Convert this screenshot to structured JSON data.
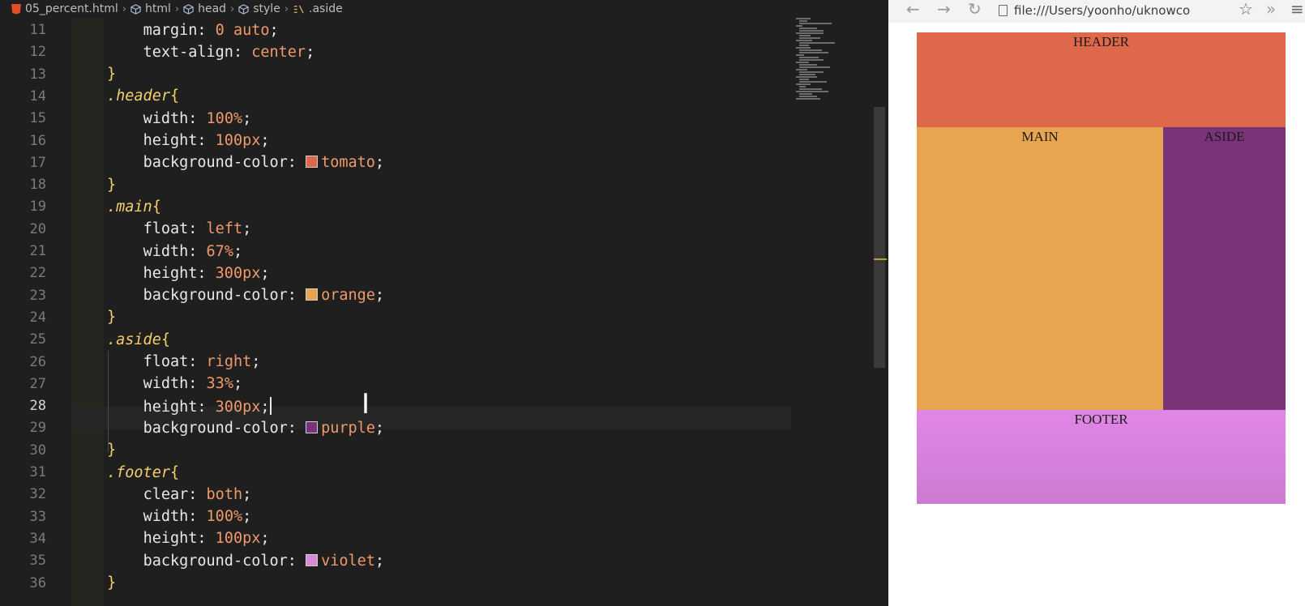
{
  "editor": {
    "breadcrumb": [
      "05_percent.html",
      "html",
      "head",
      "style",
      ".aside"
    ],
    "active_line": 28,
    "lines": [
      {
        "n": "11",
        "tokens": [
          {
            "t": "    ",
            "c": "prop"
          },
          {
            "t": "margin",
            "c": "prop"
          },
          {
            "t": ": ",
            "c": "punc"
          },
          {
            "t": "0",
            "c": "num"
          },
          {
            "t": " auto",
            "c": "val"
          },
          {
            "t": ";",
            "c": "punc"
          }
        ]
      },
      {
        "n": "12",
        "tokens": [
          {
            "t": "    ",
            "c": "prop"
          },
          {
            "t": "text-align",
            "c": "prop"
          },
          {
            "t": ": ",
            "c": "punc"
          },
          {
            "t": "center",
            "c": "val"
          },
          {
            "t": ";",
            "c": "punc"
          }
        ]
      },
      {
        "n": "13",
        "tokens": [
          {
            "t": "}",
            "c": "brace"
          }
        ]
      },
      {
        "n": "14",
        "tokens": [
          {
            "t": ".header",
            "c": "sel"
          },
          {
            "t": "{",
            "c": "brace"
          }
        ]
      },
      {
        "n": "15",
        "tokens": [
          {
            "t": "    ",
            "c": "prop"
          },
          {
            "t": "width",
            "c": "prop"
          },
          {
            "t": ": ",
            "c": "punc"
          },
          {
            "t": "100%",
            "c": "num"
          },
          {
            "t": ";",
            "c": "punc"
          }
        ]
      },
      {
        "n": "16",
        "tokens": [
          {
            "t": "    ",
            "c": "prop"
          },
          {
            "t": "height",
            "c": "prop"
          },
          {
            "t": ": ",
            "c": "punc"
          },
          {
            "t": "100px",
            "c": "num"
          },
          {
            "t": ";",
            "c": "punc"
          }
        ]
      },
      {
        "n": "17",
        "tokens": [
          {
            "t": "    ",
            "c": "prop"
          },
          {
            "t": "background-color",
            "c": "prop"
          },
          {
            "t": ": ",
            "c": "punc"
          },
          {
            "sw": "#e0684a"
          },
          {
            "t": "tomato",
            "c": "val"
          },
          {
            "t": ";",
            "c": "punc"
          }
        ]
      },
      {
        "n": "18",
        "tokens": [
          {
            "t": "}",
            "c": "brace"
          }
        ]
      },
      {
        "n": "19",
        "tokens": [
          {
            "t": ".main",
            "c": "sel"
          },
          {
            "t": "{",
            "c": "brace"
          }
        ]
      },
      {
        "n": "20",
        "tokens": [
          {
            "t": "    ",
            "c": "prop"
          },
          {
            "t": "float",
            "c": "prop"
          },
          {
            "t": ": ",
            "c": "punc"
          },
          {
            "t": "left",
            "c": "val"
          },
          {
            "t": ";",
            "c": "punc"
          }
        ]
      },
      {
        "n": "21",
        "tokens": [
          {
            "t": "    ",
            "c": "prop"
          },
          {
            "t": "width",
            "c": "prop"
          },
          {
            "t": ": ",
            "c": "punc"
          },
          {
            "t": "67%",
            "c": "num"
          },
          {
            "t": ";",
            "c": "punc"
          }
        ]
      },
      {
        "n": "22",
        "tokens": [
          {
            "t": "    ",
            "c": "prop"
          },
          {
            "t": "height",
            "c": "prop"
          },
          {
            "t": ": ",
            "c": "punc"
          },
          {
            "t": "300px",
            "c": "num"
          },
          {
            "t": ";",
            "c": "punc"
          }
        ]
      },
      {
        "n": "23",
        "tokens": [
          {
            "t": "    ",
            "c": "prop"
          },
          {
            "t": "background-color",
            "c": "prop"
          },
          {
            "t": ": ",
            "c": "punc"
          },
          {
            "sw": "#e8a550"
          },
          {
            "t": "orange",
            "c": "val"
          },
          {
            "t": ";",
            "c": "punc"
          }
        ]
      },
      {
        "n": "24",
        "tokens": [
          {
            "t": "}",
            "c": "brace"
          }
        ]
      },
      {
        "n": "25",
        "tokens": [
          {
            "t": ".aside",
            "c": "sel"
          },
          {
            "t": "{",
            "c": "brace"
          }
        ]
      },
      {
        "n": "26",
        "tokens": [
          {
            "t": "    ",
            "c": "prop"
          },
          {
            "t": "float",
            "c": "prop"
          },
          {
            "t": ": ",
            "c": "punc"
          },
          {
            "t": "right",
            "c": "val"
          },
          {
            "t": ";",
            "c": "punc"
          }
        ]
      },
      {
        "n": "27",
        "tokens": [
          {
            "t": "    ",
            "c": "prop"
          },
          {
            "t": "width",
            "c": "prop"
          },
          {
            "t": ": ",
            "c": "punc"
          },
          {
            "t": "33%",
            "c": "num"
          },
          {
            "t": ";",
            "c": "punc"
          }
        ]
      },
      {
        "n": "28",
        "tokens": [
          {
            "t": "    ",
            "c": "prop"
          },
          {
            "t": "height",
            "c": "prop"
          },
          {
            "t": ": ",
            "c": "punc"
          },
          {
            "t": "300px",
            "c": "num"
          },
          {
            "t": ";",
            "c": "punc"
          },
          {
            "caret": true
          }
        ]
      },
      {
        "n": "29",
        "tokens": [
          {
            "t": "    ",
            "c": "prop"
          },
          {
            "t": "background-color",
            "c": "prop"
          },
          {
            "t": ": ",
            "c": "punc"
          },
          {
            "sw": "#7a3279"
          },
          {
            "t": "purple",
            "c": "val"
          },
          {
            "t": ";",
            "c": "punc"
          }
        ]
      },
      {
        "n": "30",
        "tokens": [
          {
            "t": "}",
            "c": "brace"
          }
        ]
      },
      {
        "n": "31",
        "tokens": [
          {
            "t": ".footer",
            "c": "sel"
          },
          {
            "t": "{",
            "c": "brace"
          }
        ]
      },
      {
        "n": "32",
        "tokens": [
          {
            "t": "    ",
            "c": "prop"
          },
          {
            "t": "clear",
            "c": "prop"
          },
          {
            "t": ": ",
            "c": "punc"
          },
          {
            "t": "both",
            "c": "val"
          },
          {
            "t": ";",
            "c": "punc"
          }
        ]
      },
      {
        "n": "33",
        "tokens": [
          {
            "t": "    ",
            "c": "prop"
          },
          {
            "t": "width",
            "c": "prop"
          },
          {
            "t": ": ",
            "c": "punc"
          },
          {
            "t": "100%",
            "c": "num"
          },
          {
            "t": ";",
            "c": "punc"
          }
        ]
      },
      {
        "n": "34",
        "tokens": [
          {
            "t": "    ",
            "c": "prop"
          },
          {
            "t": "height",
            "c": "prop"
          },
          {
            "t": ": ",
            "c": "punc"
          },
          {
            "t": "100px",
            "c": "num"
          },
          {
            "t": ";",
            "c": "punc"
          }
        ]
      },
      {
        "n": "35",
        "tokens": [
          {
            "t": "    ",
            "c": "prop"
          },
          {
            "t": "background-color",
            "c": "prop"
          },
          {
            "t": ": ",
            "c": "punc"
          },
          {
            "sw": "#d98ad6"
          },
          {
            "t": "violet",
            "c": "val"
          },
          {
            "t": ";",
            "c": "punc"
          }
        ]
      },
      {
        "n": "36",
        "tokens": [
          {
            "t": "}",
            "c": "brace"
          }
        ]
      }
    ]
  },
  "browser": {
    "url": "file:///Users/yoonho/uknowco",
    "nav_icons": [
      "back-arrow-icon",
      "forward-arrow-icon",
      "reload-icon",
      "star-icon",
      "chevrons-icon",
      "menu-icon"
    ],
    "demo": {
      "header_label": "HEADER",
      "main_label": "MAIN",
      "aside_label": "ASIDE",
      "footer_label": "FOOTER"
    }
  }
}
